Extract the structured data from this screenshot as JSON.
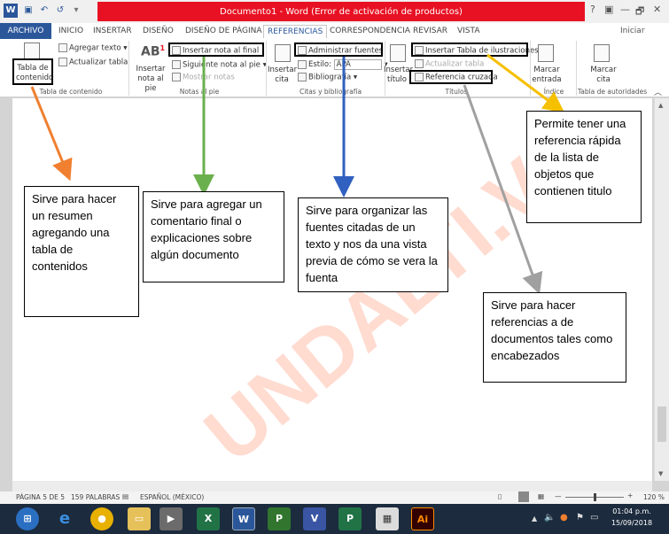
{
  "window": {
    "title": "Documento1 - Word (Error de activación de productos)",
    "controls": [
      "?",
      "▣",
      "—",
      "🗗",
      "✕"
    ],
    "signin": "Iniciar sesión"
  },
  "tabs": {
    "file": "ARCHIVO",
    "items": [
      "INICIO",
      "INSERTAR",
      "DISEÑO",
      "DISEÑO DE PÁGINA",
      "REFERENCIAS",
      "CORRESPONDENCIA",
      "REVISAR",
      "VISTA"
    ],
    "active": "REFERENCIAS"
  },
  "ribbon": {
    "toc": {
      "button": "Tabla de contenido",
      "add_text": "Agregar texto",
      "update": "Actualizar tabla",
      "group": "Tabla de contenido"
    },
    "footnotes": {
      "insert_footnote": "Insertar nota al pie",
      "insert_endnote": "Insertar nota al final",
      "next_footnote": "Siguiente nota al pie",
      "show_notes": "Mostrar notas",
      "group": "Notas al pie",
      "icon_text": "AB"
    },
    "citations": {
      "insert_citation": "Insertar cita",
      "manage_sources": "Administrar fuentes",
      "style_label": "Estilo:",
      "style_value": "APA",
      "bibliography": "Bibliografía",
      "group": "Citas y bibliografía"
    },
    "captions": {
      "insert_caption": "Insertar título",
      "insert_table_figures": "Insertar Tabla de ilustraciones",
      "update_table": "Actualizar tabla",
      "cross_reference": "Referencia cruzada",
      "group": "Títulos"
    },
    "index": {
      "mark_entry": "Marcar entrada",
      "group": "Índice"
    },
    "authorities": {
      "mark_citation": "Marcar cita",
      "group": "Tabla de autoridades"
    }
  },
  "annotations": {
    "toc": "Sirve para hacer un resumen agregando una tabla de contenidos",
    "endnote": "Sirve para agregar un comentario final o explicaciones sobre algún documento",
    "sources": "Sirve para organizar las fuentes citadas de un texto y nos da una vista previa de cómo se vera la fuenta",
    "table_figures": "Permite tener una referencia rápida de la lista de objetos que contienen titulo",
    "cross_ref": "Sirve para hacer referencias a de documentos tales como encabezados"
  },
  "watermark": "UNDALTI.V",
  "statusbar": {
    "page": "PÁGINA 5 DE 5",
    "words": "159 PALABRAS",
    "language": "ESPAÑOL (MÉXICO)",
    "zoom": "120 %"
  },
  "taskbar": {
    "time": "01:04 p.m.",
    "date": "15/09/2018"
  },
  "colors": {
    "title_red": "#e81123",
    "word_blue": "#2b579a",
    "arrow_orange": "#f08030",
    "arrow_green": "#6ab04c",
    "arrow_blue": "#3060c0",
    "arrow_yellow": "#f5c000",
    "arrow_gray": "#a0a0a0"
  }
}
